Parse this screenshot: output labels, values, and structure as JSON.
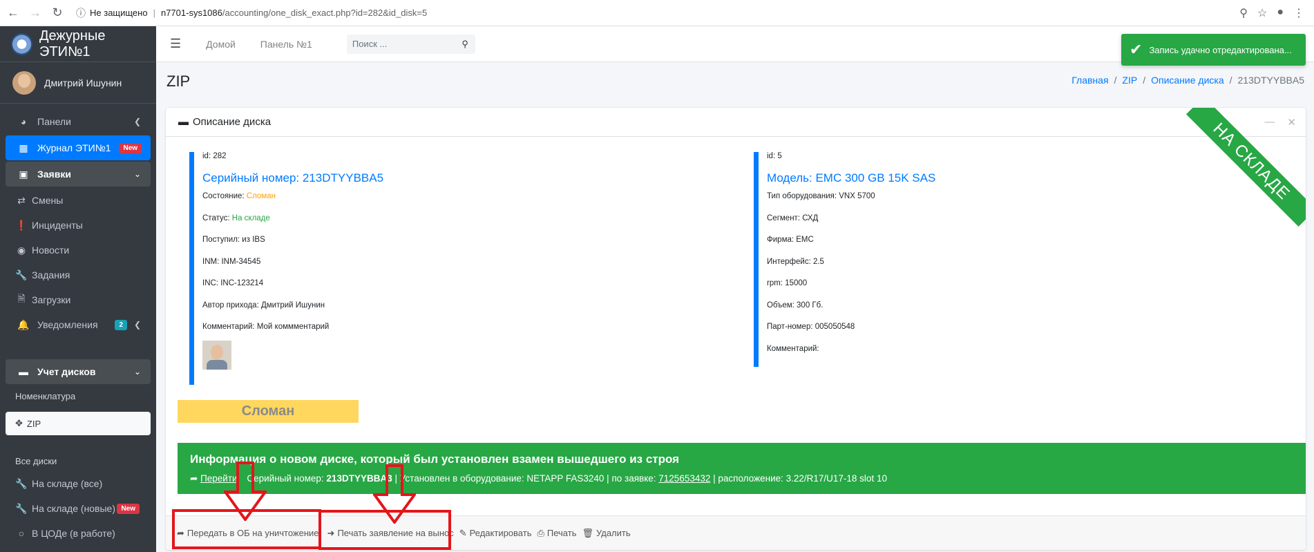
{
  "browser": {
    "not_secure": "Не защищено",
    "host": "n7701-sys1086",
    "path": "/accounting/one_disk_exact.php?id=282&id_disk=5"
  },
  "sidebar": {
    "brand": "Дежурные ЭТИ№1",
    "user": "Дмитрий Ишунин",
    "items": [
      {
        "label": "Панели",
        "icon": "dashboard-icon"
      },
      {
        "label": "Журнал ЭТИ№1",
        "badge": "New",
        "icon": "table-icon"
      },
      {
        "label": "Заявки",
        "icon": "inbox-icon"
      },
      {
        "label": "Смены",
        "icon": "exchange-icon"
      },
      {
        "label": "Инциденты",
        "icon": "exclamation-icon"
      },
      {
        "label": "Новости",
        "icon": "eye-icon"
      },
      {
        "label": "Задания",
        "icon": "wrench-icon"
      },
      {
        "label": "Загрузки",
        "icon": "file-icon"
      },
      {
        "label": "Уведомления",
        "badge": "2",
        "icon": "bell-icon"
      }
    ],
    "disks_section": "Учет дисков",
    "nomenclature_header": "Номенклатура",
    "zip_item": "ZIP",
    "all_disks_header": "Все диски",
    "sub_items": [
      {
        "label": "На складе (все)",
        "icon": "wrench-icon"
      },
      {
        "label": "На складе (новые)",
        "badge": "New",
        "icon": "wrench-icon"
      },
      {
        "label": "В ЦОДе (в работе)",
        "icon": "circle-icon"
      }
    ]
  },
  "topnav": {
    "home": "Домой",
    "panel": "Панель №1",
    "search_placeholder": "Поиск ..."
  },
  "toast": "Запись удачно отредактирована...",
  "page": {
    "title": "ZIP",
    "breadcrumb": [
      "Главная",
      "ZIP",
      "Описание диска",
      "213DTYYBBA5"
    ]
  },
  "card": {
    "title": "Описание диска",
    "ribbon": "НА СКЛАДЕ",
    "left": {
      "id": "id: 282",
      "heading": "Серийный номер: 213DTYYBBA5",
      "state_label": "Состояние:",
      "state_value": "Сломан",
      "status_label": "Статус:",
      "status_value": "На складе",
      "received": "Поступил: из IBS",
      "inm": "INM: INM-34545",
      "inc": "INC: INC-123214",
      "author": "Автор прихода: Дмитрий Ишунин",
      "comment": "Комментарий: Мой коммментарий"
    },
    "right": {
      "id": "id: 5",
      "heading": "Модель: EMC 300 GB 15K SAS",
      "type": "Тип оборудования: VNX 5700",
      "segment": "Сегмент: СХД",
      "firm": "Фирма: EMC",
      "interface": "Интерфейс: 2.5",
      "rpm": "rpm: 15000",
      "volume": "Объем: 300 Гб.",
      "part": "Парт-номер: 005050548",
      "comment": "Комментарий:"
    },
    "status_big": "Сломан",
    "info": {
      "heading": "Информация о новом диске, который был установлен взамен вышедшего из строя",
      "go_link": "Перейти",
      "serial_label": "Серийный номер:",
      "serial_value": "213DTYYBBA3",
      "installed": "| Установлен в оборудование: NETAPP FAS3240 | по заявке:",
      "ticket": "7125653432",
      "location": "| расположение: 3.22/R17/U17-18 slot 10"
    },
    "actions": {
      "transfer": "Передать в ОБ на уничтожение",
      "print_statement": "Печать заявление на вынос",
      "edit": "Редактировать",
      "print": "Печать",
      "delete": "Удалить"
    }
  }
}
